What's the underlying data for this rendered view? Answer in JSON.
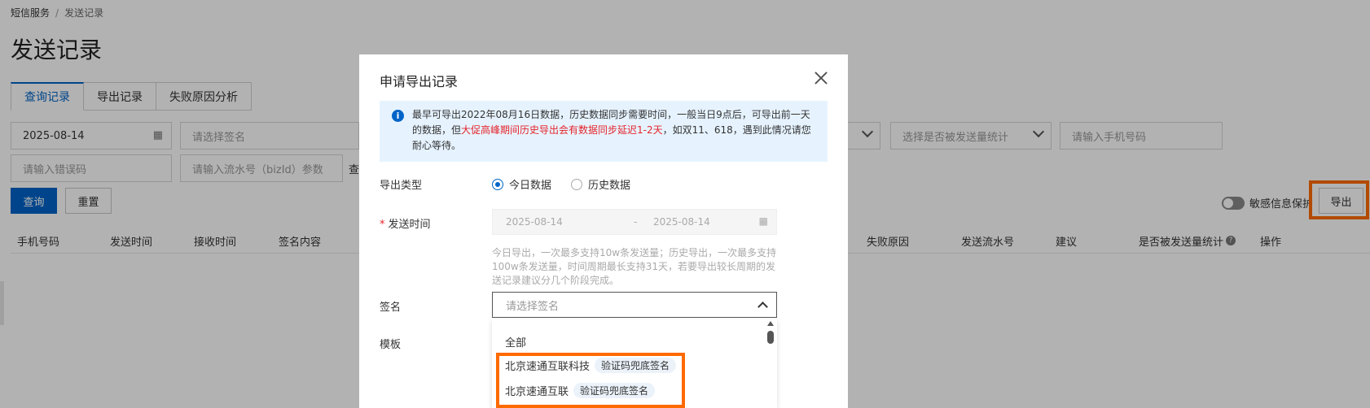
{
  "breadcrumb": {
    "root": "短信服务",
    "sep": "/",
    "current": "发送记录"
  },
  "page_title": "发送记录",
  "tabs": [
    {
      "label": "查询记录",
      "active": true
    },
    {
      "label": "导出记录",
      "active": false
    },
    {
      "label": "失败原因分析",
      "active": false
    }
  ],
  "filters": {
    "date_value": "2025-08-14",
    "signature_placeholder": "请选择签名",
    "stat_placeholder": "选择是否被发送量统计",
    "phone_placeholder": "请输入手机号码",
    "error_code_placeholder": "请输入错误码",
    "bizid_placeholder": "请输入流水号（bizId）参数",
    "query_hint_partial": "查"
  },
  "buttons": {
    "query": "查询",
    "reset": "重置",
    "export": "导出"
  },
  "toggle_label": "敏感信息保护",
  "table_headers": [
    "手机号码",
    "发送时间",
    "接收时间",
    "签名内容",
    "失败原因",
    "发送流水号",
    "建议",
    "是否被发送量统计",
    "操作"
  ],
  "help_glyph": "?",
  "modal": {
    "title": "申请导出记录",
    "notice_before": "最早可导出2022年08月16日数据，历史数据同步需要时间，一般当日9点后，可导出前一天的数据，但",
    "notice_red": "大促高峰期间历史导出会有数据同步延迟1-2天",
    "notice_after": "，如双11、618，遇到此情况请您耐心等待。",
    "export_type_label": "导出类型",
    "export_type_options": [
      "今日数据",
      "历史数据"
    ],
    "send_time_label": "发送时间",
    "required_mark": "*",
    "start_date": "2025-08-14",
    "range_sep": "-",
    "end_date": "2025-08-14",
    "hint": "今日导出，一次最多支持10w条发送量；历史导出，一次最多支持100w条发送量，时间周期最长支持31天，若要导出较长周期的发送记录建议分几个阶段完成。",
    "signature_label": "签名",
    "signature_placeholder": "请选择签名",
    "template_label": "模板",
    "dropdown_items": [
      {
        "name": "全部",
        "tag": ""
      },
      {
        "name": "北京速通互联科技",
        "tag": "验证码兜底签名"
      },
      {
        "name": "北京速通互联",
        "tag": "验证码兜底签名"
      }
    ]
  },
  "colors": {
    "primary": "#0064c8",
    "highlight": "#ff6a00",
    "danger": "#e5242b"
  }
}
